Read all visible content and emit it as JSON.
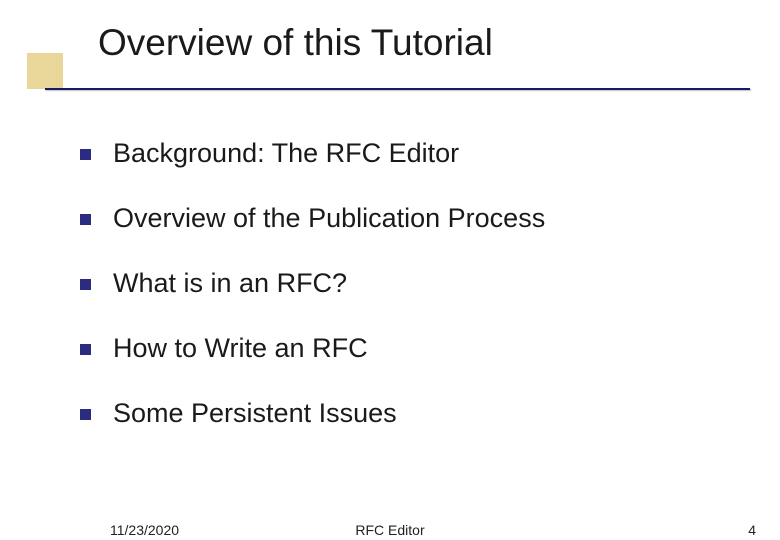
{
  "title": "Overview of this Tutorial",
  "bullets": [
    "Background: The RFC Editor",
    "Overview of the Publication Process",
    "What is in an RFC?",
    "How to Write an RFC",
    "Some Persistent Issues"
  ],
  "footer": {
    "date": "11/23/2020",
    "center": "RFC Editor",
    "page": "4"
  }
}
